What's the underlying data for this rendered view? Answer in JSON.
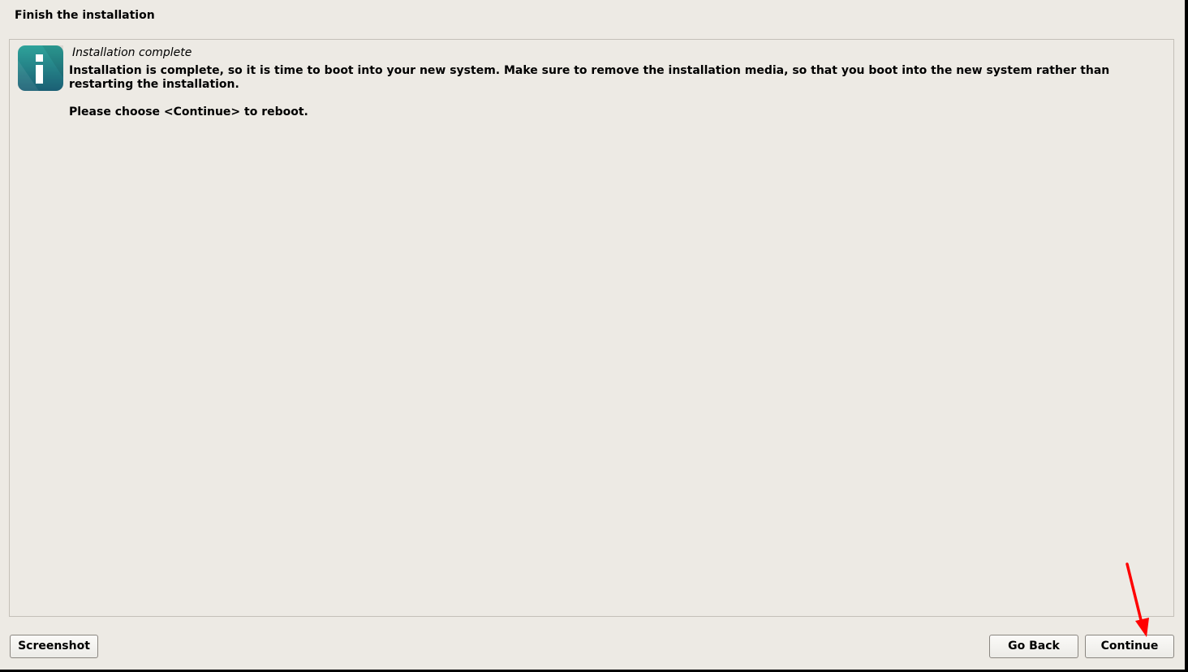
{
  "page": {
    "title": "Finish the installation"
  },
  "message": {
    "icon": "info-icon",
    "heading": "Installation complete",
    "body": "Installation is complete, so it is time to boot into your new system. Make sure to remove the installation media, so that you boot into the new system rather than restarting the installation.",
    "instruction": "Please choose <Continue> to reboot."
  },
  "buttons": {
    "screenshot": "Screenshot",
    "go_back": "Go Back",
    "continue": "Continue"
  },
  "annotation": {
    "type": "arrow",
    "points_to": "continue-button",
    "color": "#ff0000"
  },
  "colors": {
    "background": "#edeae4",
    "icon_gradient_top": "#2ea39a",
    "icon_gradient_bottom": "#1b5f74"
  }
}
